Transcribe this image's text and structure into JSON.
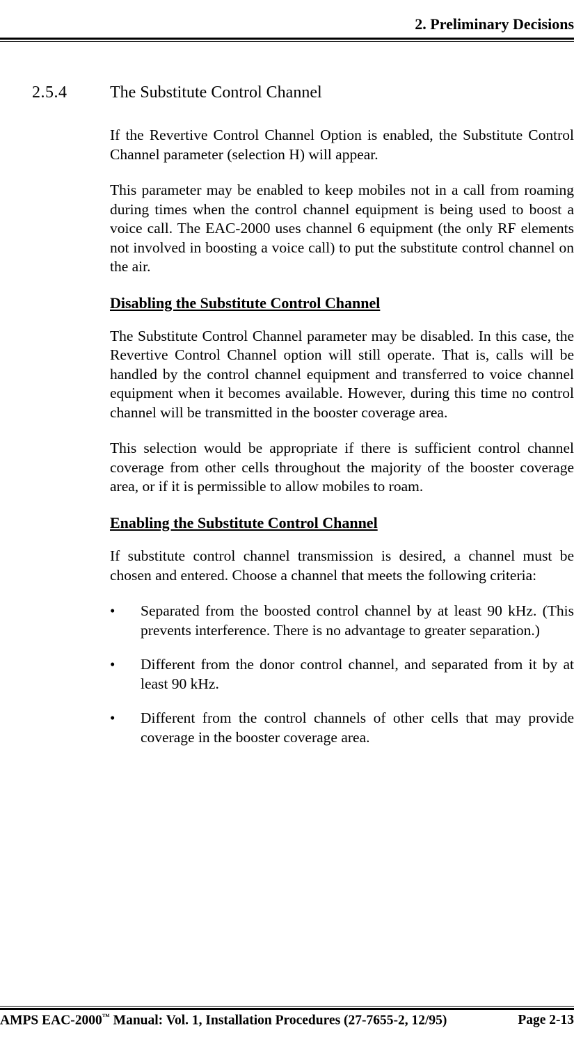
{
  "header": {
    "chapter": "2.  Preliminary Decisions"
  },
  "section": {
    "number": "2.5.4",
    "title": "The Substitute Control Channel"
  },
  "paragraphs": {
    "p1": "If the Revertive Control Channel Option is enabled, the Substitute Control Channel parameter (selection H) will appear.",
    "p2": "This parameter may be enabled to keep mobiles not in a call from roaming during times when the control channel equipment is being used to boost a voice call.  The EAC-2000 uses channel 6 equipment (the only RF elements not involved in boosting a voice call) to put the substitute control channel on the air.",
    "h1": "Disabling the Substitute Control Channel",
    "p3": "The Substitute Control Channel parameter may be disabled.  In this case, the Revertive Control Channel option will still operate.  That is, calls will be handled by the control channel equipment and transferred to voice channel equipment when it becomes available. However, during this time no control channel will be transmitted in the booster coverage area.",
    "p4": "This selection would be appropriate if there is sufficient control channel coverage from other cells throughout the majority of the booster coverage area, or if it is permissible to allow mobiles to roam.",
    "h2": "Enabling the Substitute Control Channel",
    "p5": "If substitute control channel transmission is desired, a channel must be chosen and entered.  Choose a channel that meets the following criteria:"
  },
  "bullets": [
    "Separated from the boosted control channel by at least 90 kHz. (This prevents interference.  There is no advantage to greater separation.)",
    "Different from the donor control channel, and separated from it by at least 90 kHz.",
    "Different from the control channels of other cells that may provide coverage in the booster coverage area."
  ],
  "footer": {
    "left_prefix": "AMPS EAC-2000",
    "left_suffix": " Manual:  Vol. 1, Installation Procedures (27-7655-2, 12/95)",
    "right": "Page 2-13",
    "tm": "™"
  }
}
